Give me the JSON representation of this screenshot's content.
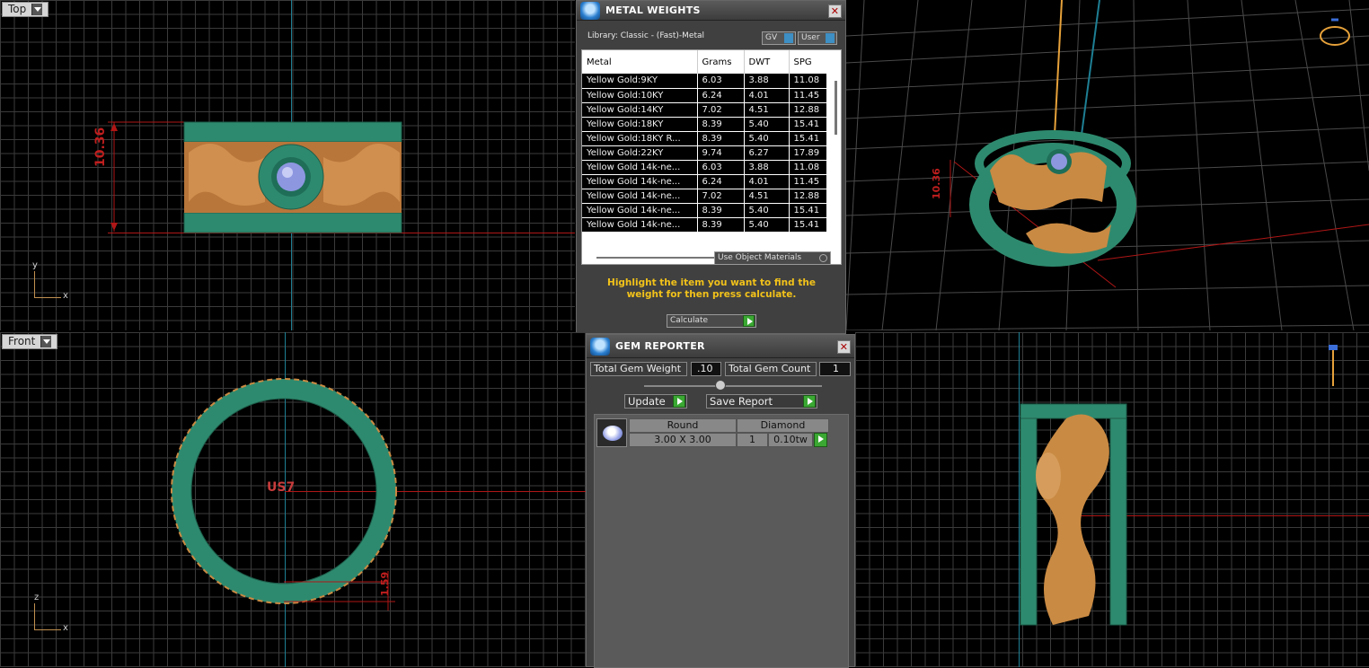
{
  "viewports": {
    "top": {
      "label": "Top",
      "axis_y": "y",
      "axis_x": "x",
      "dimension": "10.36"
    },
    "perspective": {
      "dimension": "10.36"
    },
    "front": {
      "label": "Front",
      "axis_z": "z",
      "axis_x": "x",
      "ring_size": "US7",
      "dimension": "1.59"
    },
    "right": {}
  },
  "metal_weights": {
    "title": "METAL WEIGHTS",
    "library": "Library: Classic - (Fast)-Metal",
    "gv_label": "GV",
    "user_label": "User",
    "columns": [
      "Metal",
      "Grams",
      "DWT",
      "SPG"
    ],
    "rows": [
      [
        "Yellow Gold:9KY",
        "6.03",
        "3.88",
        "11.08"
      ],
      [
        "Yellow Gold:10KY",
        "6.24",
        "4.01",
        "11.45"
      ],
      [
        "Yellow Gold:14KY",
        "7.02",
        "4.51",
        "12.88"
      ],
      [
        "Yellow Gold:18KY",
        "8.39",
        "5.40",
        "15.41"
      ],
      [
        "Yellow Gold:18KY R...",
        "8.39",
        "5.40",
        "15.41"
      ],
      [
        "Yellow Gold:22KY",
        "9.74",
        "6.27",
        "17.89"
      ],
      [
        "Yellow Gold 14k-ne...",
        "6.03",
        "3.88",
        "11.08"
      ],
      [
        "Yellow Gold 14k-ne...",
        "6.24",
        "4.01",
        "11.45"
      ],
      [
        "Yellow Gold 14k-ne...",
        "7.02",
        "4.51",
        "12.88"
      ],
      [
        "Yellow Gold 14k-ne...",
        "8.39",
        "5.40",
        "15.41"
      ],
      [
        "Yellow Gold 14k-ne...",
        "8.39",
        "5.40",
        "15.41"
      ]
    ],
    "use_object_materials": "Use Object Materials",
    "hint": "Highlight the item you want to find the weight for then press calculate.",
    "calculate": "Calculate"
  },
  "gem_reporter": {
    "title": "GEM REPORTER",
    "total_weight_label": "Total Gem Weight",
    "total_weight_value": ".10",
    "total_count_label": "Total Gem Count",
    "total_count_value": "1",
    "update": "Update",
    "save_report": "Save Report",
    "gem": {
      "shape": "Round",
      "material": "Diamond",
      "size": "3.00 X 3.00",
      "count": "1",
      "weight": "0.10tw"
    }
  },
  "colors": {
    "band_green": "#2e8a6e",
    "gold": "#c98a43",
    "axis_red": "#b01616",
    "axis_cyan": "#1e7f94",
    "panel_bg": "#404040",
    "hint_yellow": "#f2c21a"
  }
}
